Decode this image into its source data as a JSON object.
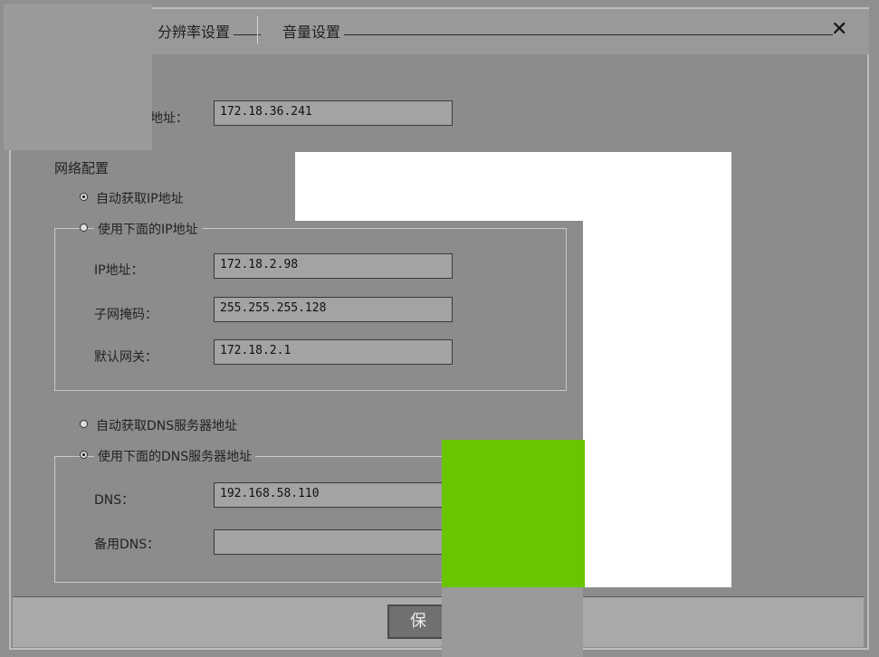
{
  "tabs": [
    {
      "label": "分辨率设置"
    },
    {
      "label": "音量设置"
    }
  ],
  "close_glyph": "✕",
  "server_address": {
    "label": "地址：",
    "value": "172.18.36.241"
  },
  "network": {
    "title": "网络配置",
    "auto_ip_label": "自动获取IP地址",
    "manual_ip_label": "使用下面的IP地址",
    "ip": {
      "label": "IP地址：",
      "value": "172.18.2.98"
    },
    "subnet": {
      "label": "子网掩码：",
      "value": "255.255.255.128"
    },
    "gateway": {
      "label": "默认网关：",
      "value": "172.18.2.1"
    },
    "auto_dns_label": "自动获取DNS服务器地址",
    "manual_dns_label": "使用下面的DNS服务器地址",
    "dns": {
      "label": "DNS：",
      "value": "192.168.58.110"
    },
    "backup_dns": {
      "label": "备用DNS：",
      "value": ""
    }
  },
  "footer": {
    "save_label": "保"
  },
  "colors": {
    "overlay_white": "#ffffff",
    "overlay_green": "#6bc400",
    "overlay_gray": "#9a9a9a"
  }
}
